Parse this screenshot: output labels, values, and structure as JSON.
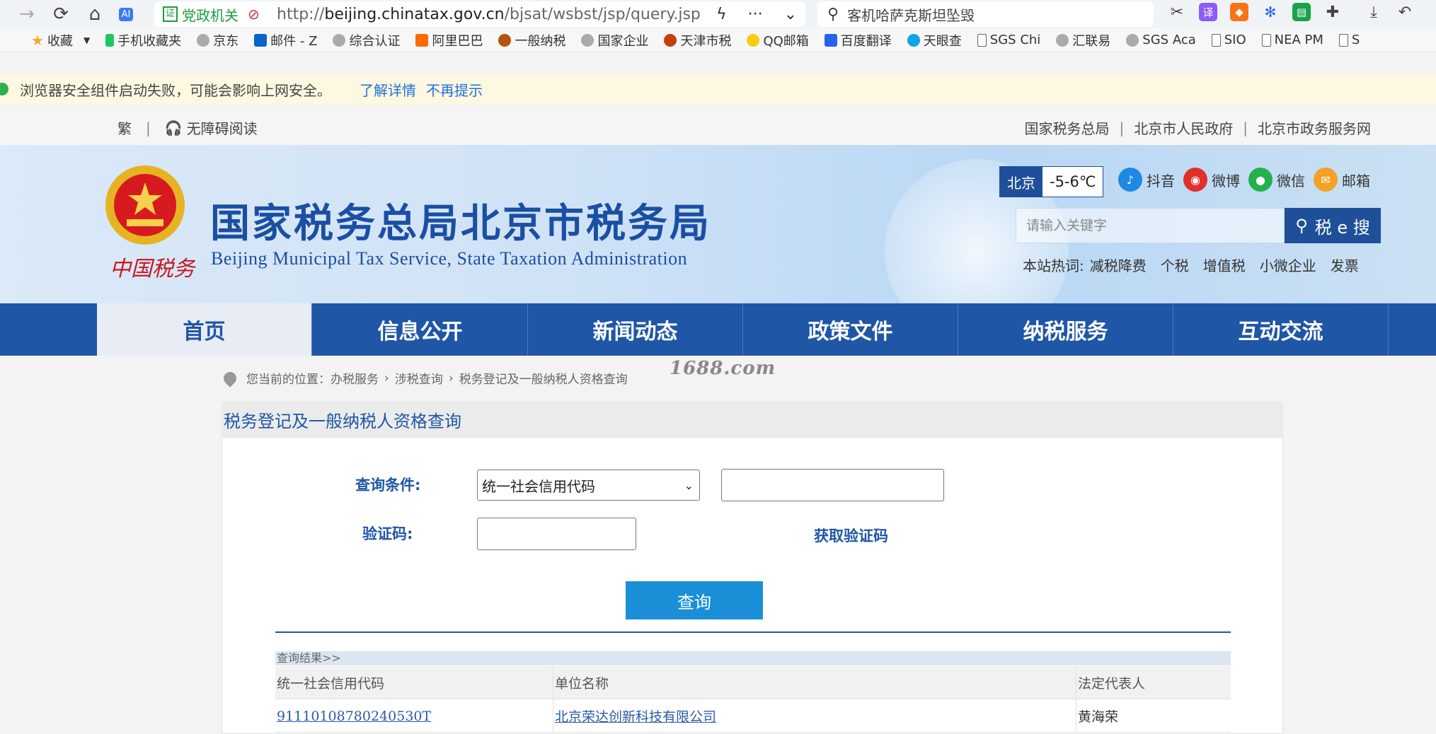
{
  "browser": {
    "url_badge": "党政机关",
    "url_badge_icon": "证",
    "url_domain": "beijing.chinatax.gov.cn",
    "url_prefix": "http://",
    "url_path": "/bjsat/wsbst/jsp/query.jsp",
    "search_text": "客机哈萨克斯坦坠毁"
  },
  "bookmarks": [
    "收藏",
    "手机收藏夹",
    "京东",
    "邮件 - Z",
    "综合认证",
    "阿里巴巴",
    "一般纳税",
    "国家企业",
    "天津市税",
    "QQ邮箱",
    "百度翻译",
    "天眼查",
    "SGS Chi",
    "汇联易",
    "SGS Aca",
    "SIO",
    "NEA PM",
    "S"
  ],
  "infobar": {
    "message": "浏览器安全组件启动失败，可能会影响上网安全。",
    "learn_more": "了解详情",
    "dismiss": "不再提示"
  },
  "topstrip": {
    "traditional": "繁",
    "accessibility": "无障碍阅读",
    "links": [
      "国家税务总局",
      "北京市人民政府",
      "北京市政务服务网"
    ]
  },
  "banner": {
    "title": "国家税务总局北京市税务局",
    "subtitle": "Beijing Municipal Tax Service, State Taxation Administration",
    "emblem_caption": "中国税务",
    "city": "北京",
    "temperature": "-5-6℃",
    "social": [
      "抖音",
      "微博",
      "微信",
      "邮箱"
    ],
    "search_placeholder": "请输入关键字",
    "search_button": "税 e 搜",
    "hot_label": "本站热词:",
    "hot_words": [
      "减税降费",
      "个税",
      "增值税",
      "小微企业",
      "发票"
    ]
  },
  "nav": [
    "首页",
    "信息公开",
    "新闻动态",
    "政策文件",
    "纳税服务",
    "互动交流"
  ],
  "breadcrumb": {
    "prefix": "您当前的位置：",
    "items": [
      "办税服务",
      "涉税查询",
      "税务登记及一般纳税人资格查询"
    ]
  },
  "watermark": "1688.com",
  "form": {
    "panel_title": "税务登记及一般纳税人资格查询",
    "condition_label": "查询条件:",
    "condition_selected": "统一社会信用代码",
    "captcha_label": "验证码:",
    "get_code": "获取验证码",
    "query_button": "查询"
  },
  "results": {
    "header": "查询结果>>",
    "columns": [
      "统一社会信用代码",
      "单位名称",
      "法定代表人"
    ],
    "rows": [
      [
        "91110108780240530T",
        "北京荣达创新科技有限公司",
        "黄海荣"
      ]
    ]
  },
  "colors": {
    "nav_blue": "#1f56a6",
    "query_button": "#1a8fd8",
    "infobar_bg": "#fdf8e1"
  }
}
